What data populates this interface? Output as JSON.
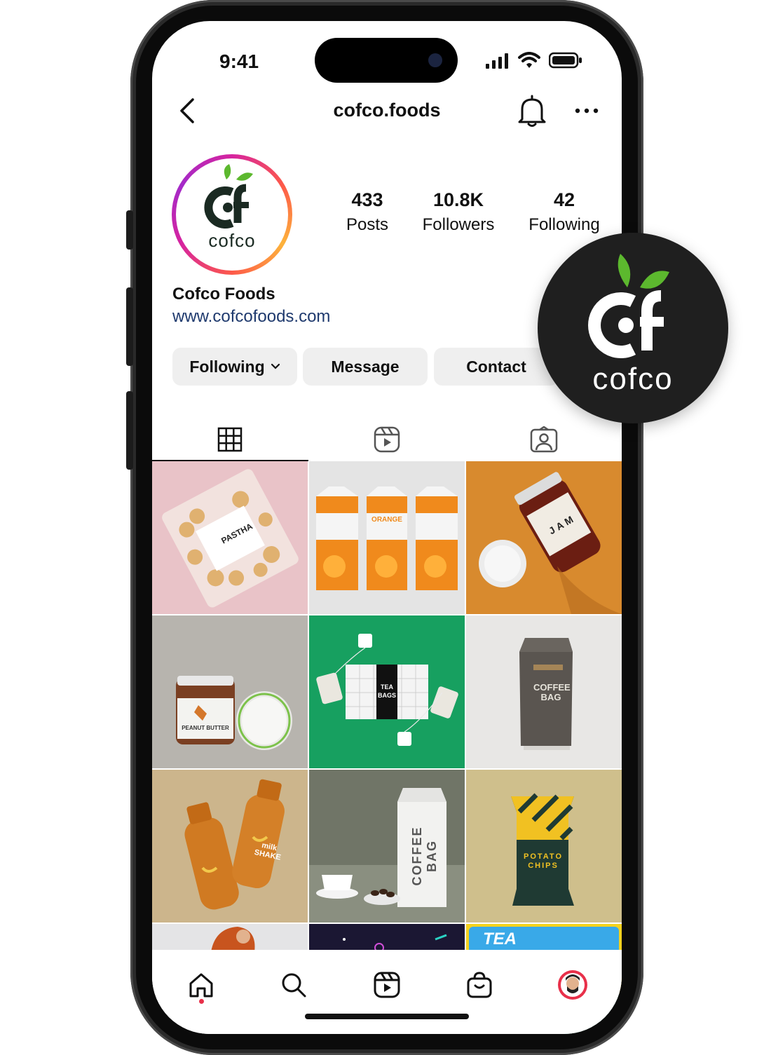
{
  "status_bar": {
    "time": "9:41"
  },
  "header": {
    "username": "cofco.foods"
  },
  "profile": {
    "avatar_text": "cofco",
    "display_name": "Cofco Foods",
    "website": "www.cofcofoods.com",
    "stats": [
      {
        "value": "433",
        "label": "Posts"
      },
      {
        "value": "10.8K",
        "label": "Followers"
      },
      {
        "value": "42",
        "label": "Following"
      }
    ]
  },
  "actions": {
    "following": "Following",
    "message": "Message",
    "contact": "Contact"
  },
  "tabs": [
    {
      "name": "posts-grid-icon"
    },
    {
      "name": "reels-icon"
    },
    {
      "name": "tagged-icon"
    }
  ],
  "grid": {
    "posts": [
      {
        "subject": "pasta-bag",
        "text": "PASTHA"
      },
      {
        "subject": "orange-juice-cartons",
        "text": "ORANGE"
      },
      {
        "subject": "jam-jar",
        "text": "JAM"
      },
      {
        "subject": "peanut-butter-jar",
        "text": "PEANUT BUTTER"
      },
      {
        "subject": "tea-bags-box",
        "text": "TEA BAGS"
      },
      {
        "subject": "coffee-bag-dark",
        "text": "COFFEE BAG"
      },
      {
        "subject": "banana-milk-shake-bottles",
        "text": "milk SHAKE"
      },
      {
        "subject": "coffee-bag-white",
        "text": "COFFEE BAG"
      },
      {
        "subject": "potato-chips-pack",
        "text": "POTATO CHIPS"
      },
      {
        "subject": "partial-person"
      },
      {
        "subject": "partial-dark-graphic"
      },
      {
        "subject": "partial-tea-graphic",
        "text": "TEA"
      }
    ]
  },
  "bottom_nav": [
    "home-icon",
    "search-icon",
    "reels-icon",
    "shop-icon",
    "profile-avatar"
  ],
  "badge": {
    "text": "cofco"
  },
  "colors": {
    "leaf_green": "#5cb82e",
    "link_blue": "#1f3a6e",
    "button_gray": "#efefef",
    "badge_dark": "#1f1f1f",
    "notification_dot": "#e8304a"
  }
}
